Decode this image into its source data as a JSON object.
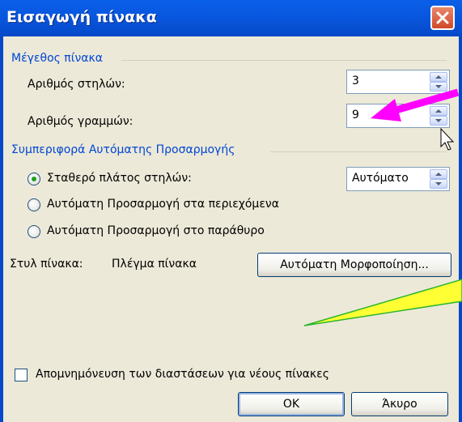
{
  "title": "Εισαγωγή πίνακα",
  "table_size": {
    "section_label": "Μέγεθος πίνακα",
    "columns_label": "Αριθμός στηλών:",
    "columns_value": "3",
    "rows_label": "Αριθμός γραμμών:",
    "rows_value": "9"
  },
  "autofit": {
    "section_label": "Συμπεριφορά Αυτόματης Προσαρμογής",
    "fixed_width_label": "Σταθερό πλάτος στηλών:",
    "fixed_width_value": "Αυτόματο",
    "fixed_width_selected": true,
    "contents_label": "Αυτόματη Προσαρμογή στα περιεχόμενα",
    "window_label": "Αυτόματη Προσαρμογή στο παράθυρο"
  },
  "table_style": {
    "label": "Στυλ πίνακα:",
    "value": "Πλέγμα πίνακα",
    "autoformat_button": "Αυτόματη Μορφοποίηση..."
  },
  "remember_label": "Απομνημόνευση των διαστάσεων για νέους πίνακες",
  "ok_button": "ΟΚ",
  "cancel_button": "Άκυρο",
  "colors": {
    "titlebar": "#0549C8",
    "section": "#0046D5",
    "arrow": "#FF00FF",
    "callout": "#FFFF33"
  }
}
